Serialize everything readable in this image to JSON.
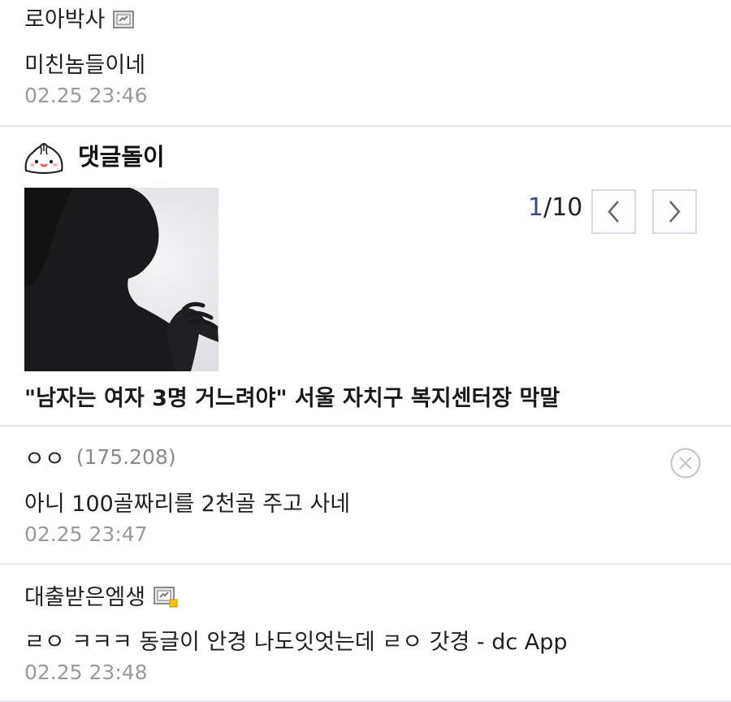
{
  "comments": [
    {
      "nickname": "로아박사",
      "text": "미친놈들이네",
      "date": "02.25 23:46",
      "icon": "gallog-icon"
    },
    {
      "nickname": "ㅇㅇ",
      "ip": "(175.208)",
      "text": "아니 100골짜리를 2천골 주고 사네",
      "date": "02.25 23:47",
      "icon": "delete-icon"
    },
    {
      "nickname": "대출받은엠생",
      "text": "ㄹㅇ ㅋㅋㅋ 동글이 안경 나도잇엇는데 ㄹㅇ 갓경 - dc App",
      "date": "02.25 23:48",
      "icon": "gallog-fixed-icon"
    }
  ],
  "bot": {
    "title": "댓글돌이",
    "icon": "dumpling-mascot-icon",
    "pager": {
      "current": "1",
      "total": "/10"
    },
    "headline": "\"남자는 여자 3명 거느려야\" 서울 자치구 복지센터장 막말",
    "prev_icon": "chevron-left-icon",
    "next_icon": "chevron-right-icon"
  },
  "colors": {
    "accent": "#3b4890",
    "divider": "#e4e4ea",
    "date": "#9a9a9a"
  }
}
